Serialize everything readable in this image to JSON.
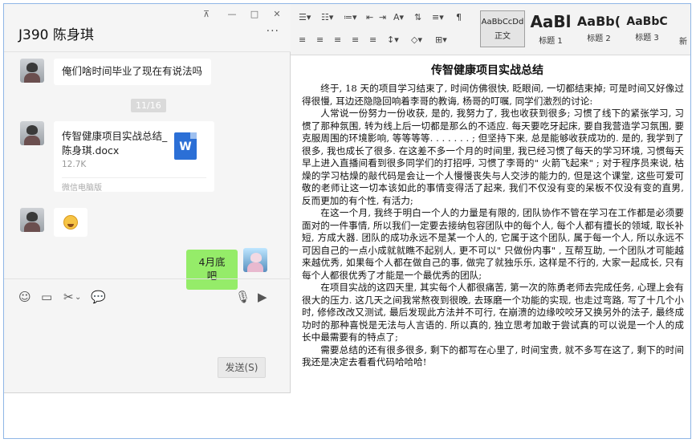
{
  "chat": {
    "title": "J390 陈身琪",
    "window_controls": {
      "pin": "⊼",
      "minimize": "—",
      "maximize": "□",
      "close": "✕"
    },
    "more": "···",
    "messages": {
      "text1": "俺们啥时间毕业了现在有说法吗",
      "time": "11/16",
      "file_name": "传智健康项目实战总结_陈身琪.docx",
      "file_size": "12.7K",
      "file_source": "微信电脑版",
      "file_icon_letter": "W",
      "reply": "4月底吧"
    },
    "send_label": "发送(S)"
  },
  "ribbon": {
    "styles": [
      {
        "sample": "AaBbCcDd",
        "name": "正文"
      },
      {
        "sample": "AaBl",
        "name": "标题 1"
      },
      {
        "sample": "AaBb(",
        "name": "标题 2"
      },
      {
        "sample": "AaBbC",
        "name": "标题 3"
      }
    ],
    "new_style": "新"
  },
  "document": {
    "title": "传智健康项目实战总结",
    "paragraphs": [
      "终于, 18 天的项目学习结束了, 时间仿佛很快, 眨眼间, 一切都结束掉; 可是时间又好像过得很慢, 耳边还隐隐回响着李哥的教诲, 杨哥的叮嘱, 同学们激烈的讨论:",
      "人常说一份努力一份收获, 是的, 我努力了, 我也收获到很多; 习惯了线下的紧张学习, 习惯了那种氛围, 转为线上后一切都是那么的不适应. 每天要吃牙起床, 要自我营造学习氛围, 要克服周围的环境影响, 等等等等. . . . . . . ; 但坚持下来, 总是能够收获成功的. 是的, 我学到了很多, 我也成长了很多. 在这差不多一个月的时间里, 我已经习惯了每天的学习环境, 习惯每天早上进入直播间看到很多同学们的打招呼, 习惯了李哥的\" 火箭飞起来\" ; 对于程序员来说, 枯燥的学习枯燥的敲代码是会让一个人慢慢丧失与人交涉的能力的, 但是这个课堂, 这些可爱可敬的老师让这一切本该如此的事情变得活了起来, 我们不仅没有变的呆板不仅没有变的直男, 反而更加的有个性, 有活力;",
      "在这一个月, 我终于明白一个人的力量是有限的, 团队协作不管在学习在工作都是必须要面对的一件事情, 所以我们一定要去接纳包容团队中的每个人, 每个人都有擅长的领域, 取长补短, 方成大器. 团队的成功永远不是某一个人的, 它属于这个团队, 属于每一个人, 所以永远不可因自己的一点小成就就瞧不起别人, 更不可以\" 只做份内事\" , 互帮互助, 一个团队才可能越来越优秀, 如果每个人都在做自己的事, 做完了就独乐乐, 这样是不行的, 大家一起成长, 只有每个人都很优秀了才能是一个最优秀的团队;",
      "在项目实战的这四天里, 其实每个人都很痛苦, 第一次的陈勇老师去完成任务, 心理上会有很大的压力. 这几天之间我常熬夜到很晚, 去琢磨一个功能的实现, 也走过弯路, 写了十几个小时, 修修改改又测试, 最后发现此方法并不可行, 在崩溃的边缘咬咬牙又换另外的法子, 最终成功时的那种喜悦是无法与人言语的. 所以真的, 独立思考加敢于尝试真的可以说是一个人的成长中最需要有的特点了;",
      "需要总结的还有很多很多, 剩下的都写在心里了, 时间宝贵, 就不多写在这了, 剩下的时间我还是决定去看看代码哈哈哈!"
    ]
  }
}
